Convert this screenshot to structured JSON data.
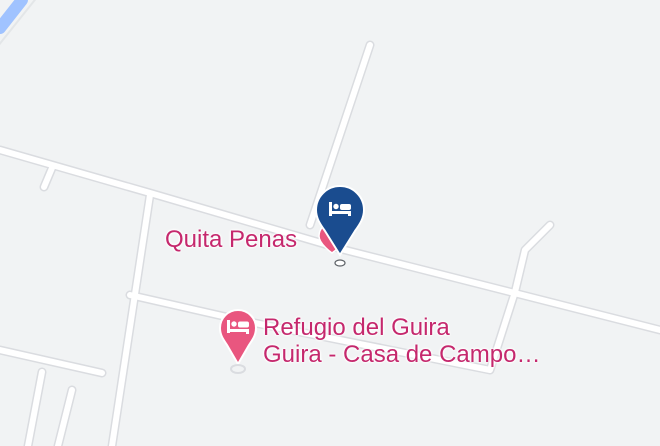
{
  "map": {
    "background_color": "#f1f3f4",
    "road_color": "#ffffff",
    "water_color": "#a0c3ff",
    "label_color": "#c5286d"
  },
  "places": [
    {
      "name": "Quita Penas",
      "category": "lodging",
      "icon": "bed-icon",
      "selected": true,
      "marker_color": "#1a4c8f"
    },
    {
      "name_line1": "Refugio del Guira",
      "name_line2": "Guira - Casa de Campo…",
      "category": "lodging",
      "icon": "bed-icon",
      "selected": false,
      "marker_color": "#e9567f"
    }
  ]
}
